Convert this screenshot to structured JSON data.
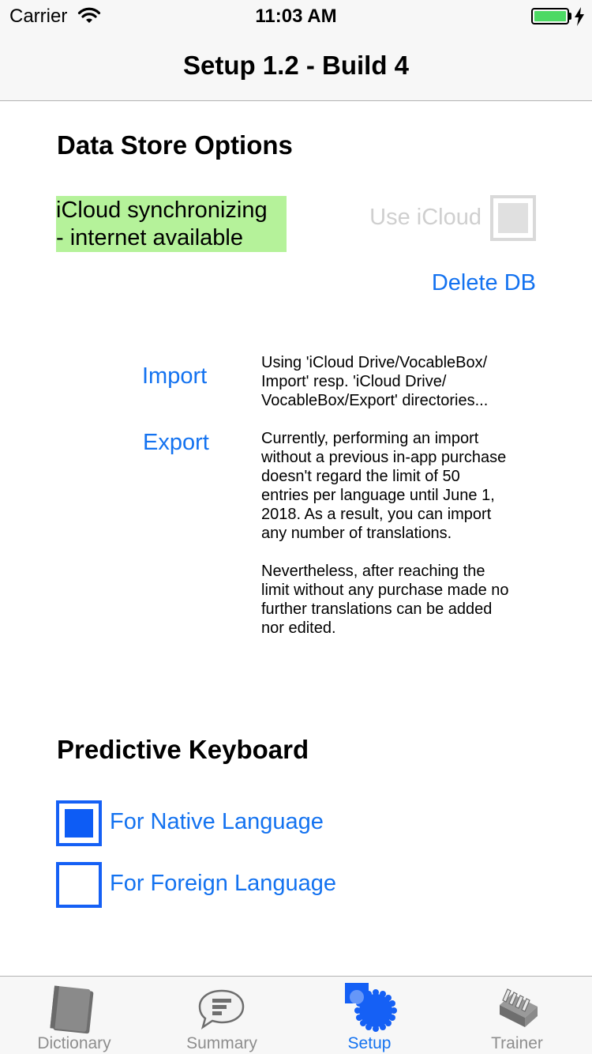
{
  "status_bar": {
    "carrier": "Carrier",
    "time": "11:03 AM"
  },
  "nav": {
    "title": "Setup 1.2 - Build 4"
  },
  "data_store": {
    "heading": "Data Store Options",
    "sync_status": "iCloud synchronizing\n- internet available",
    "use_icloud_label": "Use iCloud",
    "use_icloud_checked": false,
    "delete_db_label": "Delete DB",
    "import_label": "Import",
    "export_label": "Export",
    "import_info": "Using 'iCloud Drive/VocableBox/\nImport' resp. 'iCloud Drive/\nVocableBox/Export' directories...",
    "export_info": "Currently, performing an import\nwithout a previous in-app purchase\ndoesn't regard the limit of 50\nentries per language until June 1,\n2018. As a result, you can import\nany number of translations.\n\nNevertheless, after reaching the\nlimit without any purchase made no\nfurther translations can be added\nnor edited."
  },
  "predictive_keyboard": {
    "heading": "Predictive Keyboard",
    "native_label": "For Native Language",
    "native_checked": true,
    "foreign_label": "For Foreign Language",
    "foreign_checked": false
  },
  "tab_bar": {
    "tabs": [
      {
        "label": "Dictionary",
        "icon": "book-icon",
        "active": false
      },
      {
        "label": "Summary",
        "icon": "speech-bubble-icon",
        "active": false
      },
      {
        "label": "Setup",
        "icon": "gears-icon",
        "active": true
      },
      {
        "label": "Trainer",
        "icon": "card-box-icon",
        "active": false
      }
    ]
  },
  "colors": {
    "accent": "#1372f0",
    "sync_ok_background": "#b5f29a",
    "checkbox_blue": "#0d5cf5"
  }
}
